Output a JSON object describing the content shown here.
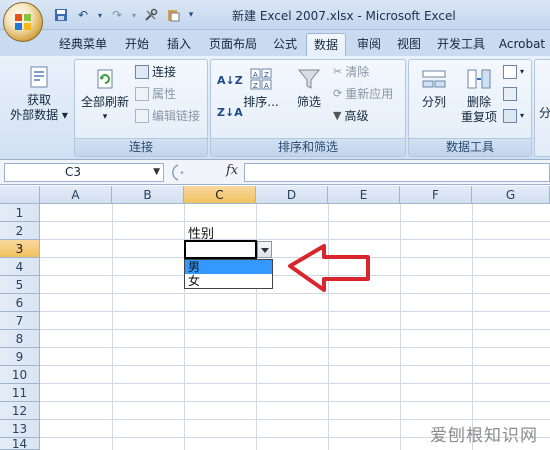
{
  "window": {
    "title": "新建 Excel 2007.xlsx - Microsoft Excel"
  },
  "ribbon_tabs": [
    {
      "label": "经典菜单"
    },
    {
      "label": "开始"
    },
    {
      "label": "插入"
    },
    {
      "label": "页面布局"
    },
    {
      "label": "公式"
    },
    {
      "label": "数据"
    },
    {
      "label": "审阅"
    },
    {
      "label": "视图"
    },
    {
      "label": "开发工具"
    },
    {
      "label": "Acrobat"
    }
  ],
  "ribbon": {
    "get_external_data": {
      "line1": "获取",
      "line2": "外部数据"
    },
    "connections_group": {
      "label": "连接",
      "refresh_all": "全部刷新",
      "connections": "连接",
      "properties": "属性",
      "edit_links": "编辑链接"
    },
    "sort_filter_group": {
      "label": "排序和筛选",
      "sort": "排序...",
      "filter": "筛选",
      "clear": "清除",
      "reapply": "重新应用",
      "advanced": "高级"
    },
    "data_tools_group": {
      "label": "数据工具",
      "split": "分列",
      "remove_dup_line1": "删除",
      "remove_dup_line2": "重复项"
    },
    "partial_right": "分"
  },
  "formula_bar": {
    "name_box": "C3",
    "fx": "fx",
    "formula": ""
  },
  "sheet": {
    "columns": [
      "A",
      "B",
      "C",
      "D",
      "E",
      "F",
      "G"
    ],
    "rows": [
      "1",
      "2",
      "3",
      "4",
      "5",
      "6",
      "7",
      "8",
      "9",
      "10",
      "11",
      "12",
      "13",
      "14"
    ],
    "selected_column": "C",
    "selected_row": "3",
    "c2_value": "性别",
    "dropdown_options": [
      "男",
      "女"
    ],
    "highlighted_option": "男"
  },
  "watermark": "爱刨根知识网",
  "colors": {
    "accent_red": "#d9262c",
    "selection_blue": "#3399ff",
    "header_selected": "#f1c15f"
  }
}
